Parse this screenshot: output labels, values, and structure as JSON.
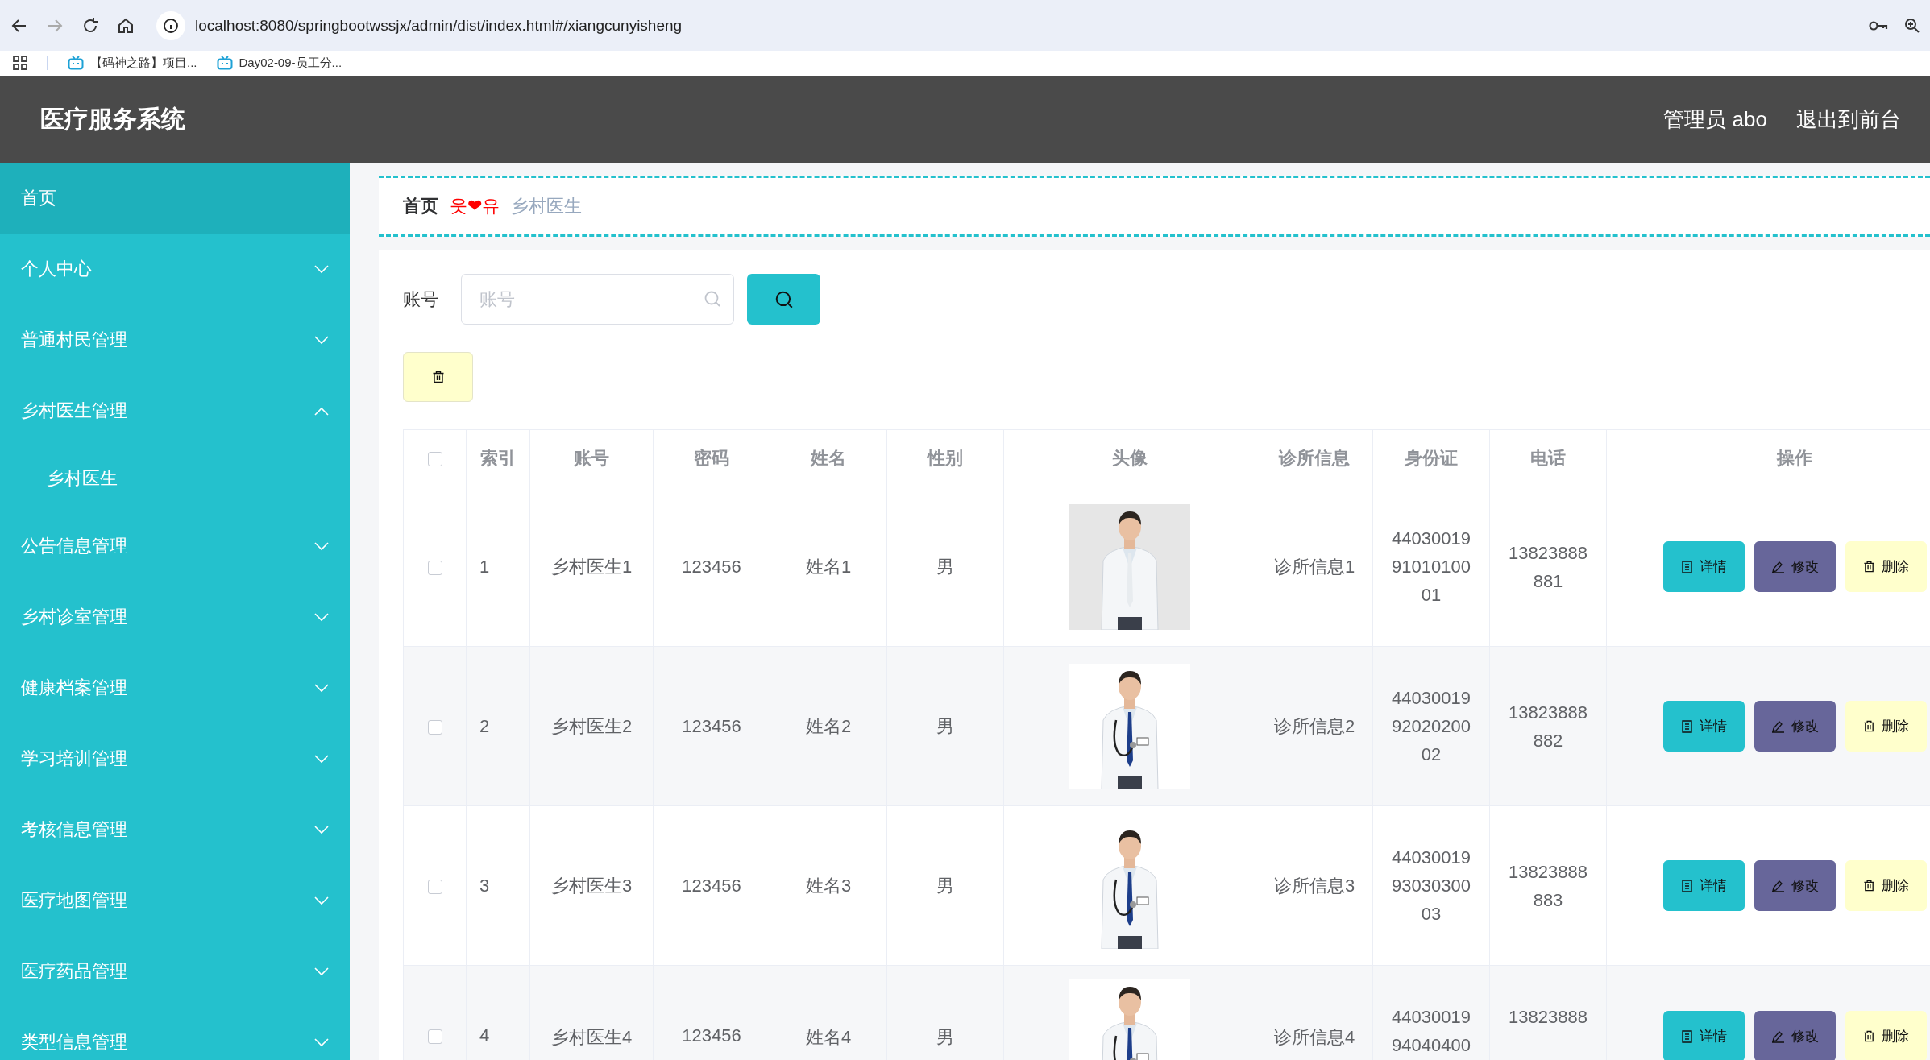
{
  "browser": {
    "url": "localhost:8080/springbootwssjx/admin/dist/index.html#/xiangcunyisheng",
    "bookmarks": [
      "【码神之路】项目...",
      "Day02-09-员工分..."
    ]
  },
  "header": {
    "title": "医疗服务系统",
    "links": [
      "管理员 abo",
      "退出到前台"
    ]
  },
  "sidebar": {
    "items": [
      {
        "kind": "link",
        "label": "首页",
        "selected": true
      },
      {
        "kind": "submenu",
        "label": "个人中心",
        "selected": false,
        "expanded": false
      },
      {
        "kind": "submenu",
        "label": "普通村民管理",
        "selected": false,
        "expanded": false
      },
      {
        "kind": "submenu",
        "label": "乡村医生管理",
        "selected": false,
        "expanded": true,
        "children": [
          {
            "label": "乡村医生",
            "selected": false
          }
        ]
      },
      {
        "kind": "submenu",
        "label": "公告信息管理",
        "selected": false,
        "expanded": false
      },
      {
        "kind": "submenu",
        "label": "乡村诊室管理",
        "selected": false,
        "expanded": false
      },
      {
        "kind": "submenu",
        "label": "健康档案管理",
        "selected": false,
        "expanded": false
      },
      {
        "kind": "submenu",
        "label": "学习培训管理",
        "selected": false,
        "expanded": false
      },
      {
        "kind": "submenu",
        "label": "考核信息管理",
        "selected": false,
        "expanded": false
      },
      {
        "kind": "submenu",
        "label": "医疗地图管理",
        "selected": false,
        "expanded": false
      },
      {
        "kind": "submenu",
        "label": "医疗药品管理",
        "selected": false,
        "expanded": false
      },
      {
        "kind": "submenu",
        "label": "类型信息管理",
        "selected": false,
        "expanded": false
      }
    ]
  },
  "breadcrumb": {
    "home": "首页",
    "separator": "웃❤유",
    "current": "乡村医生"
  },
  "search": {
    "label": "账号",
    "placeholder": "账号"
  },
  "table": {
    "columns": [
      "索引",
      "账号",
      "密码",
      "姓名",
      "性别",
      "头像",
      "诊所信息",
      "身份证",
      "电话",
      "操作"
    ],
    "all_checked": false,
    "rows": [
      {
        "checked": false,
        "index": "1",
        "account": "乡村医生1",
        "password": "123456",
        "name": "姓名1",
        "gender": "男",
        "avatar": {
          "kind": "picture"
        },
        "clinic": "诊所信息1",
        "id_card": "440300199101010001",
        "phone": "13823888881",
        "actions": [
          {
            "kind": "detail",
            "label": "详情"
          },
          {
            "kind": "edit",
            "label": "修改"
          },
          {
            "kind": "delete",
            "label": "删除"
          }
        ]
      },
      {
        "checked": false,
        "index": "2",
        "account": "乡村医生2",
        "password": "123456",
        "name": "姓名2",
        "gender": "男",
        "avatar": {
          "kind": "picture"
        },
        "clinic": "诊所信息2",
        "id_card": "440300199202020002",
        "phone": "13823888882",
        "actions": [
          {
            "kind": "detail",
            "label": "详情"
          },
          {
            "kind": "edit",
            "label": "修改"
          },
          {
            "kind": "delete",
            "label": "删除"
          }
        ]
      },
      {
        "checked": false,
        "index": "3",
        "account": "乡村医生3",
        "password": "123456",
        "name": "姓名3",
        "gender": "男",
        "avatar": {
          "kind": "picture"
        },
        "clinic": "诊所信息3",
        "id_card": "440300199303030003",
        "phone": "13823888883",
        "actions": [
          {
            "kind": "detail",
            "label": "详情"
          },
          {
            "kind": "edit",
            "label": "修改"
          },
          {
            "kind": "delete",
            "label": "删除"
          }
        ]
      },
      {
        "checked": false,
        "index": "4",
        "account": "乡村医生4",
        "password": "123456",
        "name": "姓名4",
        "gender": "男",
        "avatar": {
          "kind": "picture"
        },
        "clinic": "诊所信息4",
        "id_card": "4403001994040400",
        "phone": "13823888",
        "actions": [
          {
            "kind": "detail",
            "label": "详情"
          },
          {
            "kind": "edit",
            "label": "修改"
          },
          {
            "kind": "delete",
            "label": "删除"
          }
        ]
      }
    ]
  }
}
